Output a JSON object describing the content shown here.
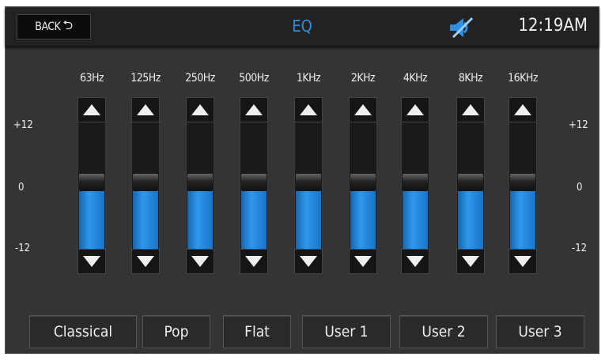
{
  "header": {
    "back_label": "BACK",
    "title": "EQ",
    "time": "12:19AM",
    "status_icon": "mute-icon"
  },
  "scale": {
    "top": "+12",
    "mid": "0",
    "bottom": "-12"
  },
  "range": {
    "min": -12,
    "max": 12
  },
  "bands": [
    {
      "label": "63Hz",
      "value": 0
    },
    {
      "label": "125Hz",
      "value": 0
    },
    {
      "label": "250Hz",
      "value": 0
    },
    {
      "label": "500Hz",
      "value": 0
    },
    {
      "label": "1KHz",
      "value": 0
    },
    {
      "label": "2KHz",
      "value": 0
    },
    {
      "label": "4KHz",
      "value": 0
    },
    {
      "label": "8KHz",
      "value": 0
    },
    {
      "label": "16KHz",
      "value": 0
    }
  ],
  "presets": [
    "Classical",
    "Pop",
    "Flat",
    "User 1",
    "User 2",
    "User 3"
  ],
  "colors": {
    "accent": "#2f8fe0",
    "background": "#343434"
  }
}
